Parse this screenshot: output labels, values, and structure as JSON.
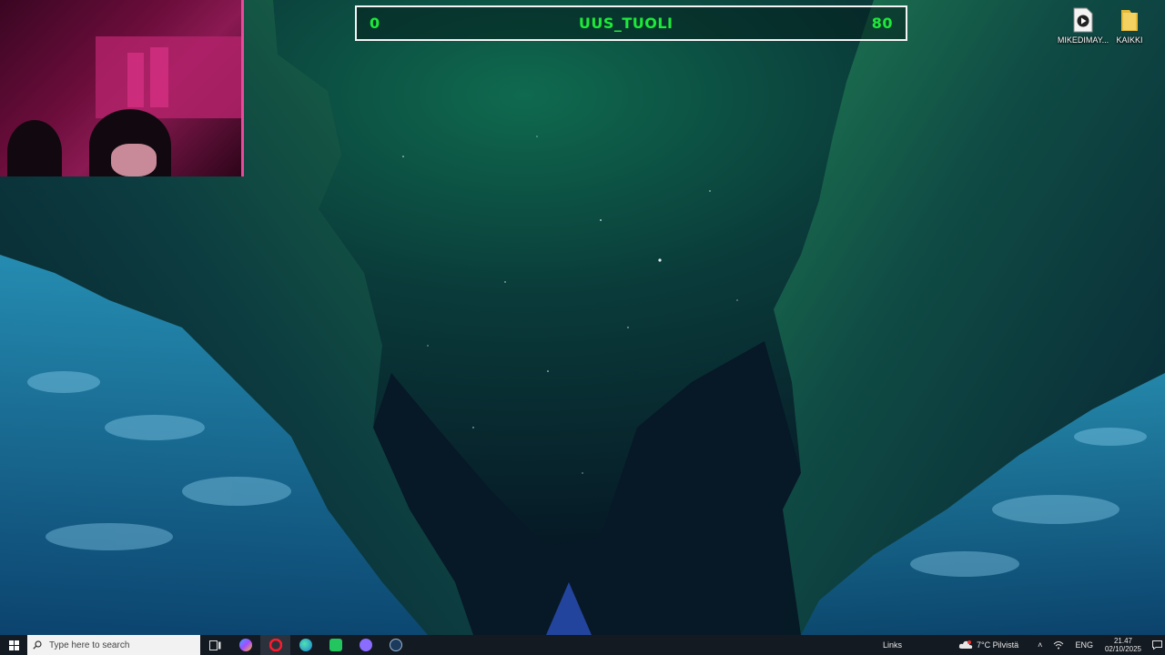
{
  "score_overlay": {
    "left_score": "0",
    "title": "UUS_TUOLI",
    "right_score": "80"
  },
  "desktop": {
    "icons": [
      {
        "label": "MIKEDIMAY...",
        "icon": "video-file-icon"
      },
      {
        "label": "KAIKKI",
        "icon": "folder-icon"
      }
    ]
  },
  "taskbar": {
    "search_placeholder": "Type here to search",
    "apps": [
      {
        "name": "task-view",
        "icon": "task-view-icon"
      },
      {
        "name": "copilot",
        "icon": "copilot-icon"
      },
      {
        "name": "opera",
        "icon": "opera-icon",
        "active": true
      },
      {
        "name": "edge",
        "icon": "edge-icon"
      },
      {
        "name": "app-green",
        "icon": "green-app-icon"
      },
      {
        "name": "discord",
        "icon": "discord-icon"
      },
      {
        "name": "steam",
        "icon": "steam-icon"
      }
    ],
    "tray": {
      "links_label": "Links",
      "weather": "7°C  Pilvistä",
      "language": "ENG",
      "time": "21.47",
      "date": "02/10/2025"
    }
  },
  "colors": {
    "score_text": "#1ee83c",
    "taskbar_bg": "#141a22",
    "webcam_accent": "#e64a9a"
  }
}
